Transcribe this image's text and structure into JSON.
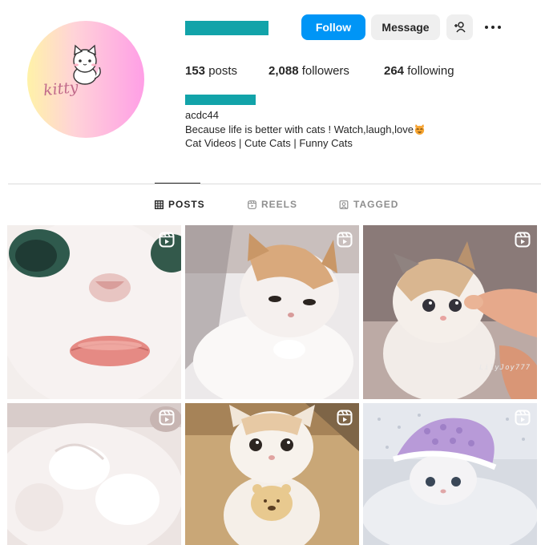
{
  "profile": {
    "avatar_text": "kitty",
    "bio_handle": "acdc44",
    "bio_line1": "Because life is better with cats ! Watch,laugh,love",
    "bio_line2": "Cat Videos | Cute Cats | Funny Cats"
  },
  "actions": {
    "follow_label": "Follow",
    "message_label": "Message",
    "adduser_icon": "add-user-icon",
    "more_icon": "more-options-icon"
  },
  "stats": {
    "posts_count": "153",
    "posts_label": "posts",
    "followers_count": "2,088",
    "followers_label": "followers",
    "following_count": "264",
    "following_label": "following"
  },
  "tabs": [
    {
      "label": "POSTS",
      "icon": "grid-icon",
      "active": true
    },
    {
      "label": "REELS",
      "icon": "reels-icon",
      "active": false
    },
    {
      "label": "TAGGED",
      "icon": "tagged-icon",
      "active": false
    }
  ],
  "posts": [
    {
      "type": "reel",
      "description": "close-up white cat face with pink lips"
    },
    {
      "type": "reel",
      "description": "orange and white cat lying down"
    },
    {
      "type": "reel",
      "description": "calico kitten touching finger",
      "watermark": "LilyJoy777"
    },
    {
      "type": "reel",
      "description": "white fluffy cat paws"
    },
    {
      "type": "reel",
      "description": "cream cat wearing bear bib"
    },
    {
      "type": "reel",
      "description": "kitten in purple knit hat"
    }
  ],
  "colors": {
    "accent": "#0095f6",
    "redacted_bar": "#12a3a9"
  }
}
